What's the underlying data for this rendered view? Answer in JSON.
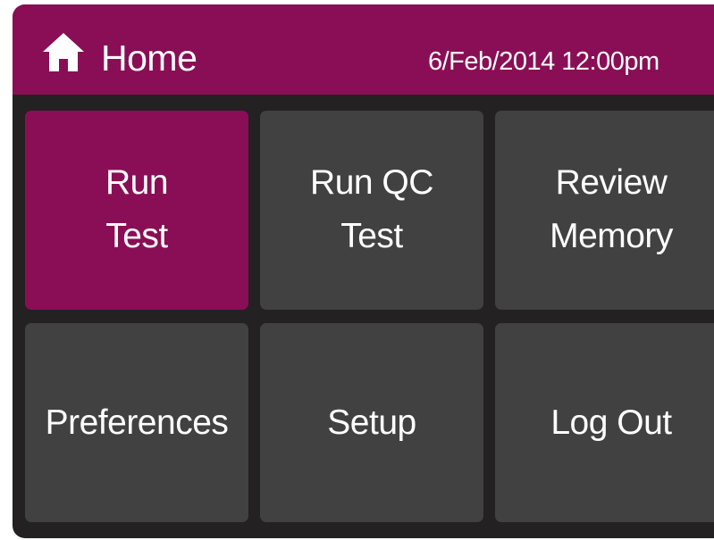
{
  "header": {
    "title": "Home",
    "datetime": "6/Feb/2014 12:00pm",
    "icon": "home-icon",
    "background_color": "#8a0e56"
  },
  "tiles": [
    {
      "label": "Run\nTest",
      "active": true
    },
    {
      "label": "Run QC\nTest",
      "active": false
    },
    {
      "label": "Review\nMemory",
      "active": false
    },
    {
      "label": "Preferences",
      "active": false
    },
    {
      "label": "Setup",
      "active": false
    },
    {
      "label": "Log Out",
      "active": false
    }
  ],
  "colors": {
    "accent": "#8a0e56",
    "tile": "#414141",
    "frame": "#232122",
    "text": "#ffffff"
  }
}
